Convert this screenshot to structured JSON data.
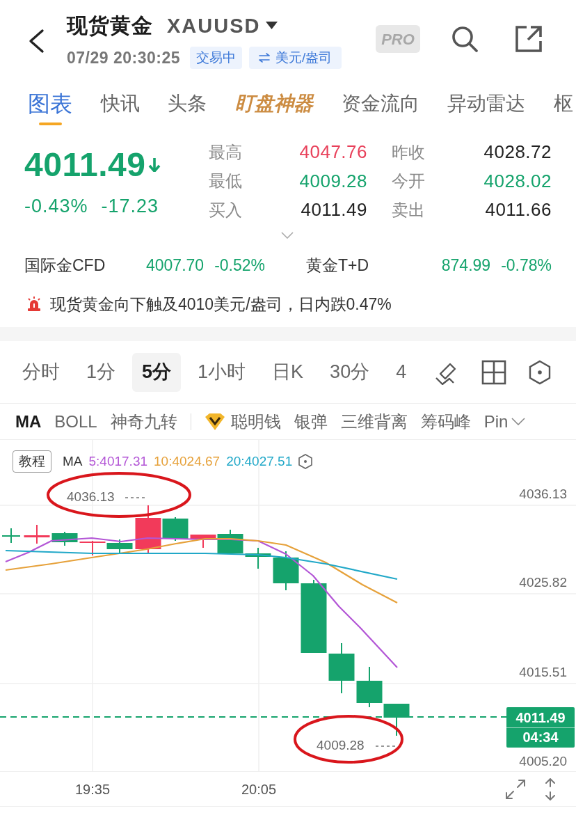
{
  "header": {
    "title": "现货黄金",
    "symbol": "XAUUSD",
    "timestamp": "07/29 20:30:25",
    "status_badge": "交易中",
    "unit_badge": "美元/盎司",
    "pro_badge": "PRO"
  },
  "tabs": [
    {
      "label": "图表",
      "kind": "plain",
      "selected": true
    },
    {
      "label": "快讯",
      "kind": "plain",
      "selected": false
    },
    {
      "label": "头条",
      "kind": "plain",
      "selected": false
    },
    {
      "label": "盯盘神器",
      "kind": "promo",
      "selected": false
    },
    {
      "label": "资金流向",
      "kind": "plain",
      "selected": false
    },
    {
      "label": "异动雷达",
      "kind": "plain",
      "selected": false
    },
    {
      "label": "枢",
      "kind": "plain",
      "selected": false
    }
  ],
  "quote": {
    "price": "4011.49",
    "falling": true,
    "change_percent": "-0.43%",
    "change": "-17.23"
  },
  "stats": [
    {
      "label": "最高",
      "value": "4047.76",
      "color": "#e8405a"
    },
    {
      "label": "昨收",
      "value": "4028.72",
      "color": "#222222"
    },
    {
      "label": "最低",
      "value": "4009.28",
      "color": "#15a36c"
    },
    {
      "label": "今开",
      "value": "4028.02",
      "color": "#15a36c"
    },
    {
      "label": "买入",
      "value": "4011.49",
      "color": "#222222"
    },
    {
      "label": "卖出",
      "value": "4011.66",
      "color": "#222222"
    }
  ],
  "related": [
    {
      "name": "国际金CFD",
      "price": "4007.70",
      "change": "-0.52%"
    },
    {
      "name": "黄金T+D",
      "price": "874.99",
      "change": "-0.78%"
    }
  ],
  "alert": {
    "text": "现货黄金向下触及4010美元/盎司，日内跌0.47%"
  },
  "periods": [
    {
      "label": "分时",
      "selected": false
    },
    {
      "label": "1分",
      "selected": false
    },
    {
      "label": "5分",
      "selected": true
    },
    {
      "label": "1小时",
      "selected": false
    },
    {
      "label": "日K",
      "selected": false
    },
    {
      "label": "30分",
      "selected": false
    },
    {
      "label": "4",
      "selected": false
    }
  ],
  "indicators": {
    "main": [
      {
        "label": "MA",
        "selected": true
      },
      {
        "label": "BOLL",
        "selected": false
      },
      {
        "label": "神奇九转",
        "selected": false
      }
    ],
    "extra": [
      {
        "label": "聪明钱",
        "kind": "premium",
        "selected": false
      },
      {
        "label": "银弹",
        "kind": "plain",
        "selected": false
      },
      {
        "label": "三维背离",
        "kind": "plain",
        "selected": false
      },
      {
        "label": "筹码峰",
        "kind": "plain",
        "selected": false
      },
      {
        "label": "Pin",
        "kind": "plain",
        "selected": false
      }
    ]
  },
  "chart": {
    "tutorial_button": "教程",
    "legend_title": "MA",
    "ma_values": [
      {
        "text": "5:4017.31",
        "color": "#b356d6"
      },
      {
        "text": "10:4024.67",
        "color": "#e6a13a"
      },
      {
        "text": "20:4027.51",
        "color": "#21a8c8"
      }
    ],
    "high_label": "4036.13",
    "low_label": "4009.28",
    "y_axis_labels": [
      "4036.13",
      "4025.82",
      "4015.51",
      "4005.20"
    ],
    "last_price_tag": {
      "price": "4011.49",
      "countdown": "04:34"
    },
    "x_axis_labels": [
      "19:35",
      "20:05"
    ]
  }
}
